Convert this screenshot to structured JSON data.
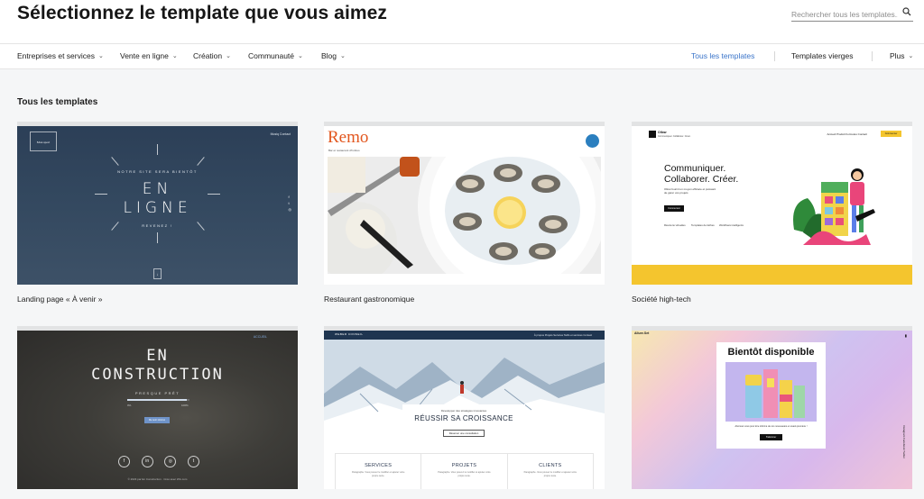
{
  "header": {
    "title": "Sélectionnez le template que vous aimez",
    "search_placeholder": "Rechercher tous les templates..."
  },
  "nav": {
    "left_items": [
      {
        "label": "Entreprises et services"
      },
      {
        "label": "Vente en ligne"
      },
      {
        "label": "Création"
      },
      {
        "label": "Communauté"
      },
      {
        "label": "Blog"
      }
    ],
    "right_items": [
      {
        "label": "Tous les templates",
        "active": true
      },
      {
        "label": "Templates vierges",
        "active": false
      },
      {
        "label": "Plus",
        "active": false
      }
    ],
    "active_color": "#3a74c9"
  },
  "section": {
    "title": "Tous les templates"
  },
  "templates": [
    {
      "label": "Landing page « À venir »",
      "preview": {
        "logo": "Mon sport",
        "nav": "Musiq  Contact",
        "small_top": "NOTRE SITE SERA BIENTÔT",
        "line1": "EN",
        "line2": "LIGNE",
        "small_bottom": "REVENEZ !"
      }
    },
    {
      "label": "Restaurant gastronomique",
      "preview": {
        "brand": "Remo",
        "tagline": "Bar et restaurant d'huîtres"
      }
    },
    {
      "label": "Société high-tech",
      "preview": {
        "logo": "Ollow",
        "logo_sub": "Communiquer. Collaborer. Créer.",
        "links": "Accueil   Produit   Formules   Contact",
        "cta": "Commencer",
        "headline_1": "Communiquer.",
        "headline_2": "Collaborer. Créer.",
        "sub": "Ollow fournit un moyen efficace et puissant de gérer vos projets",
        "button": "Commencer",
        "features": [
          "Réunions virtuelles",
          "Templates de tâches",
          "Workflows intelligents"
        ]
      }
    },
    {
      "label": "",
      "preview": {
        "account": "ACCUEIL",
        "line1": "EN",
        "line2": "CONSTRUCTION",
        "status": "PRESQUE PRÊT",
        "progress": 0.95,
        "pct_start": "0%",
        "pct_end": "100%",
        "notify": "Me tenir informé",
        "social": [
          "f",
          "in",
          "◎",
          "t"
        ],
        "footer": "© 2023 par En Construction · Créé avec Wix.com"
      }
    },
    {
      "label": "",
      "preview": {
        "brand": "WEBER CONSEIL",
        "links": "À propos   Projets   Services   Tarifs et services   Contact",
        "small": "Développer des stratégies innovantes",
        "headline": "RÉUSSIR SA CROISSANCE",
        "button": "Réserver une consultation",
        "columns": [
          {
            "title": "SERVICES",
            "text": "Paragraphe. Vous pouvez le modifier et ajouter votre propre texte."
          },
          {
            "title": "PROJETS",
            "text": "Paragraphe. Vous pouvez le modifier et ajouter votre propre texte."
          },
          {
            "title": "CLIENTS",
            "text": "Paragraphe. Vous pouvez le modifier et ajouter votre propre texte."
          }
        ]
      }
    },
    {
      "label": "",
      "preview": {
        "brand": "Allure.Set",
        "title": "Bientôt disponible",
        "text": "Abonnez-vous pour être informé de nos nouveautés en avant-première !",
        "button": "S'abonner",
        "vertical": "Instagram   Facebook   Twitter"
      }
    }
  ]
}
